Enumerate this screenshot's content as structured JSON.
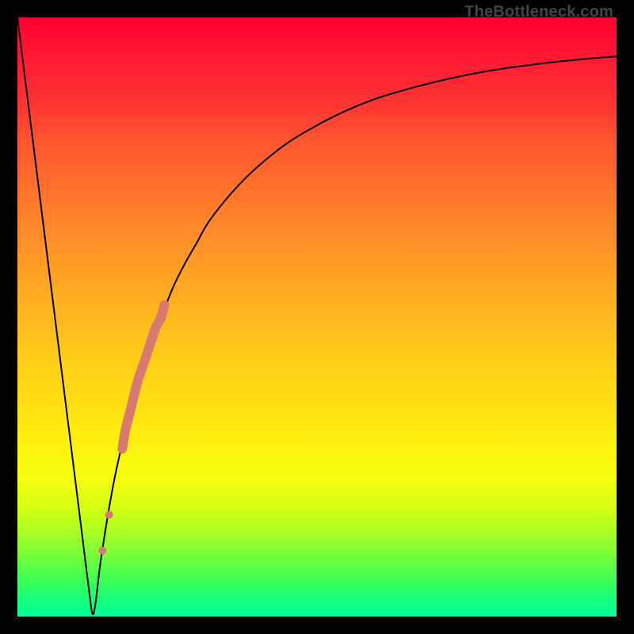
{
  "watermark": "TheBottleneck.com",
  "chart_data": {
    "type": "line",
    "title": "",
    "xlabel": "",
    "ylabel": "",
    "xlim": [
      0,
      100
    ],
    "ylim": [
      0,
      100
    ],
    "grid": false,
    "series": [
      {
        "name": "bottleneck-curve",
        "x": [
          0,
          2,
          4,
          6,
          8,
          10,
          11,
          12,
          12.5,
          13,
          14,
          16,
          18,
          20,
          22,
          24,
          26,
          28,
          30,
          32,
          36,
          40,
          45,
          50,
          55,
          60,
          65,
          70,
          75,
          80,
          85,
          90,
          95,
          100
        ],
        "y": [
          100,
          84,
          68,
          52,
          36,
          20,
          12,
          4,
          0.5,
          2,
          10,
          22,
          31,
          39,
          45,
          50,
          55,
          59,
          62.5,
          66,
          71,
          75,
          79,
          82,
          84.5,
          86.5,
          88,
          89.3,
          90.4,
          91.3,
          92,
          92.6,
          93.1,
          93.5
        ],
        "color": "#000000",
        "stroke_width": 2
      },
      {
        "name": "highlight-segment",
        "x": [
          17.5,
          18,
          19,
          20,
          21,
          22,
          23,
          24,
          24.5
        ],
        "y": [
          28,
          31,
          35,
          39,
          42,
          45,
          48,
          50,
          52
        ],
        "color": "#d97a70",
        "stroke_width": 12,
        "linecap": "round"
      }
    ],
    "points": [
      {
        "name": "highlight-dot-a",
        "x": 14.2,
        "y": 11,
        "r": 5,
        "color": "#d97a70"
      },
      {
        "name": "highlight-dot-b",
        "x": 15.3,
        "y": 17,
        "r": 5,
        "color": "#d97a70"
      }
    ],
    "background_gradient": {
      "top": "#ff0033",
      "bottom": "#00ff99"
    }
  }
}
